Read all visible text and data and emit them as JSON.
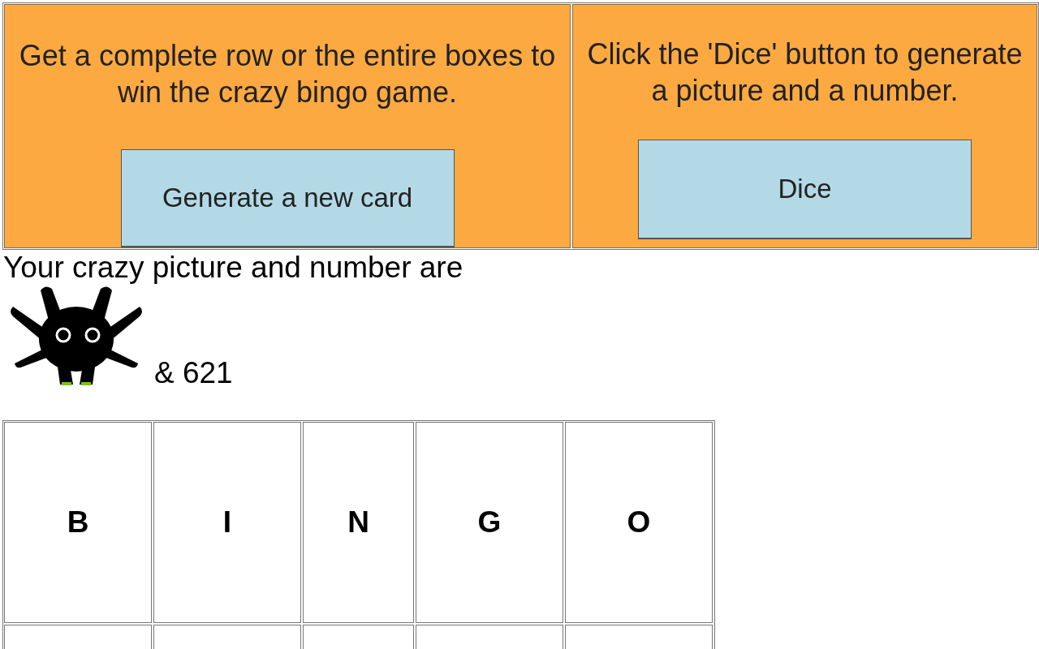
{
  "panels": [
    {
      "text": "Get a complete row or the entire boxes to win the crazy bingo game.",
      "button": "Generate a new card"
    },
    {
      "text": "Click the 'Dice' button to generate a picture and a number.",
      "button": "Dice"
    }
  ],
  "result": {
    "label": "Your crazy picture and number are",
    "number": "& 621"
  },
  "bingo": {
    "columns": [
      "B",
      "I",
      "N",
      "G",
      "O"
    ]
  }
}
